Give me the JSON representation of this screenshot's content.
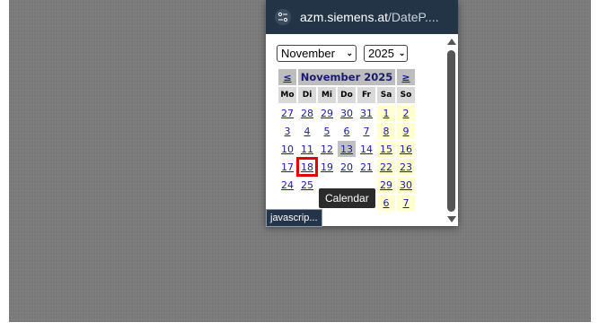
{
  "popup": {
    "url_host": "azm.siemens.at",
    "url_path": "/DateP....",
    "icon": "tune-icon"
  },
  "selectors": {
    "month": "November",
    "year": "2025"
  },
  "calendar": {
    "prev": "≤",
    "next": "≥",
    "title": "November 2025",
    "weekdays": [
      "Mo",
      "Di",
      "Mi",
      "Do",
      "Fr",
      "Sa",
      "So"
    ],
    "weeks": [
      [
        "27",
        "28",
        "29",
        "30",
        "31",
        "1",
        "2"
      ],
      [
        "3",
        "4",
        "5",
        "6",
        "7",
        "8",
        "9"
      ],
      [
        "10",
        "11",
        "12",
        "13",
        "14",
        "15",
        "16"
      ],
      [
        "17",
        "18",
        "19",
        "20",
        "21",
        "22",
        "23"
      ],
      [
        "24",
        "25",
        "",
        "",
        "",
        "29",
        "30"
      ],
      [
        "",
        "",
        "",
        "4",
        "5",
        "6",
        "7"
      ]
    ]
  },
  "tooltip": "Calendar",
  "status_bar": "javascrip..."
}
